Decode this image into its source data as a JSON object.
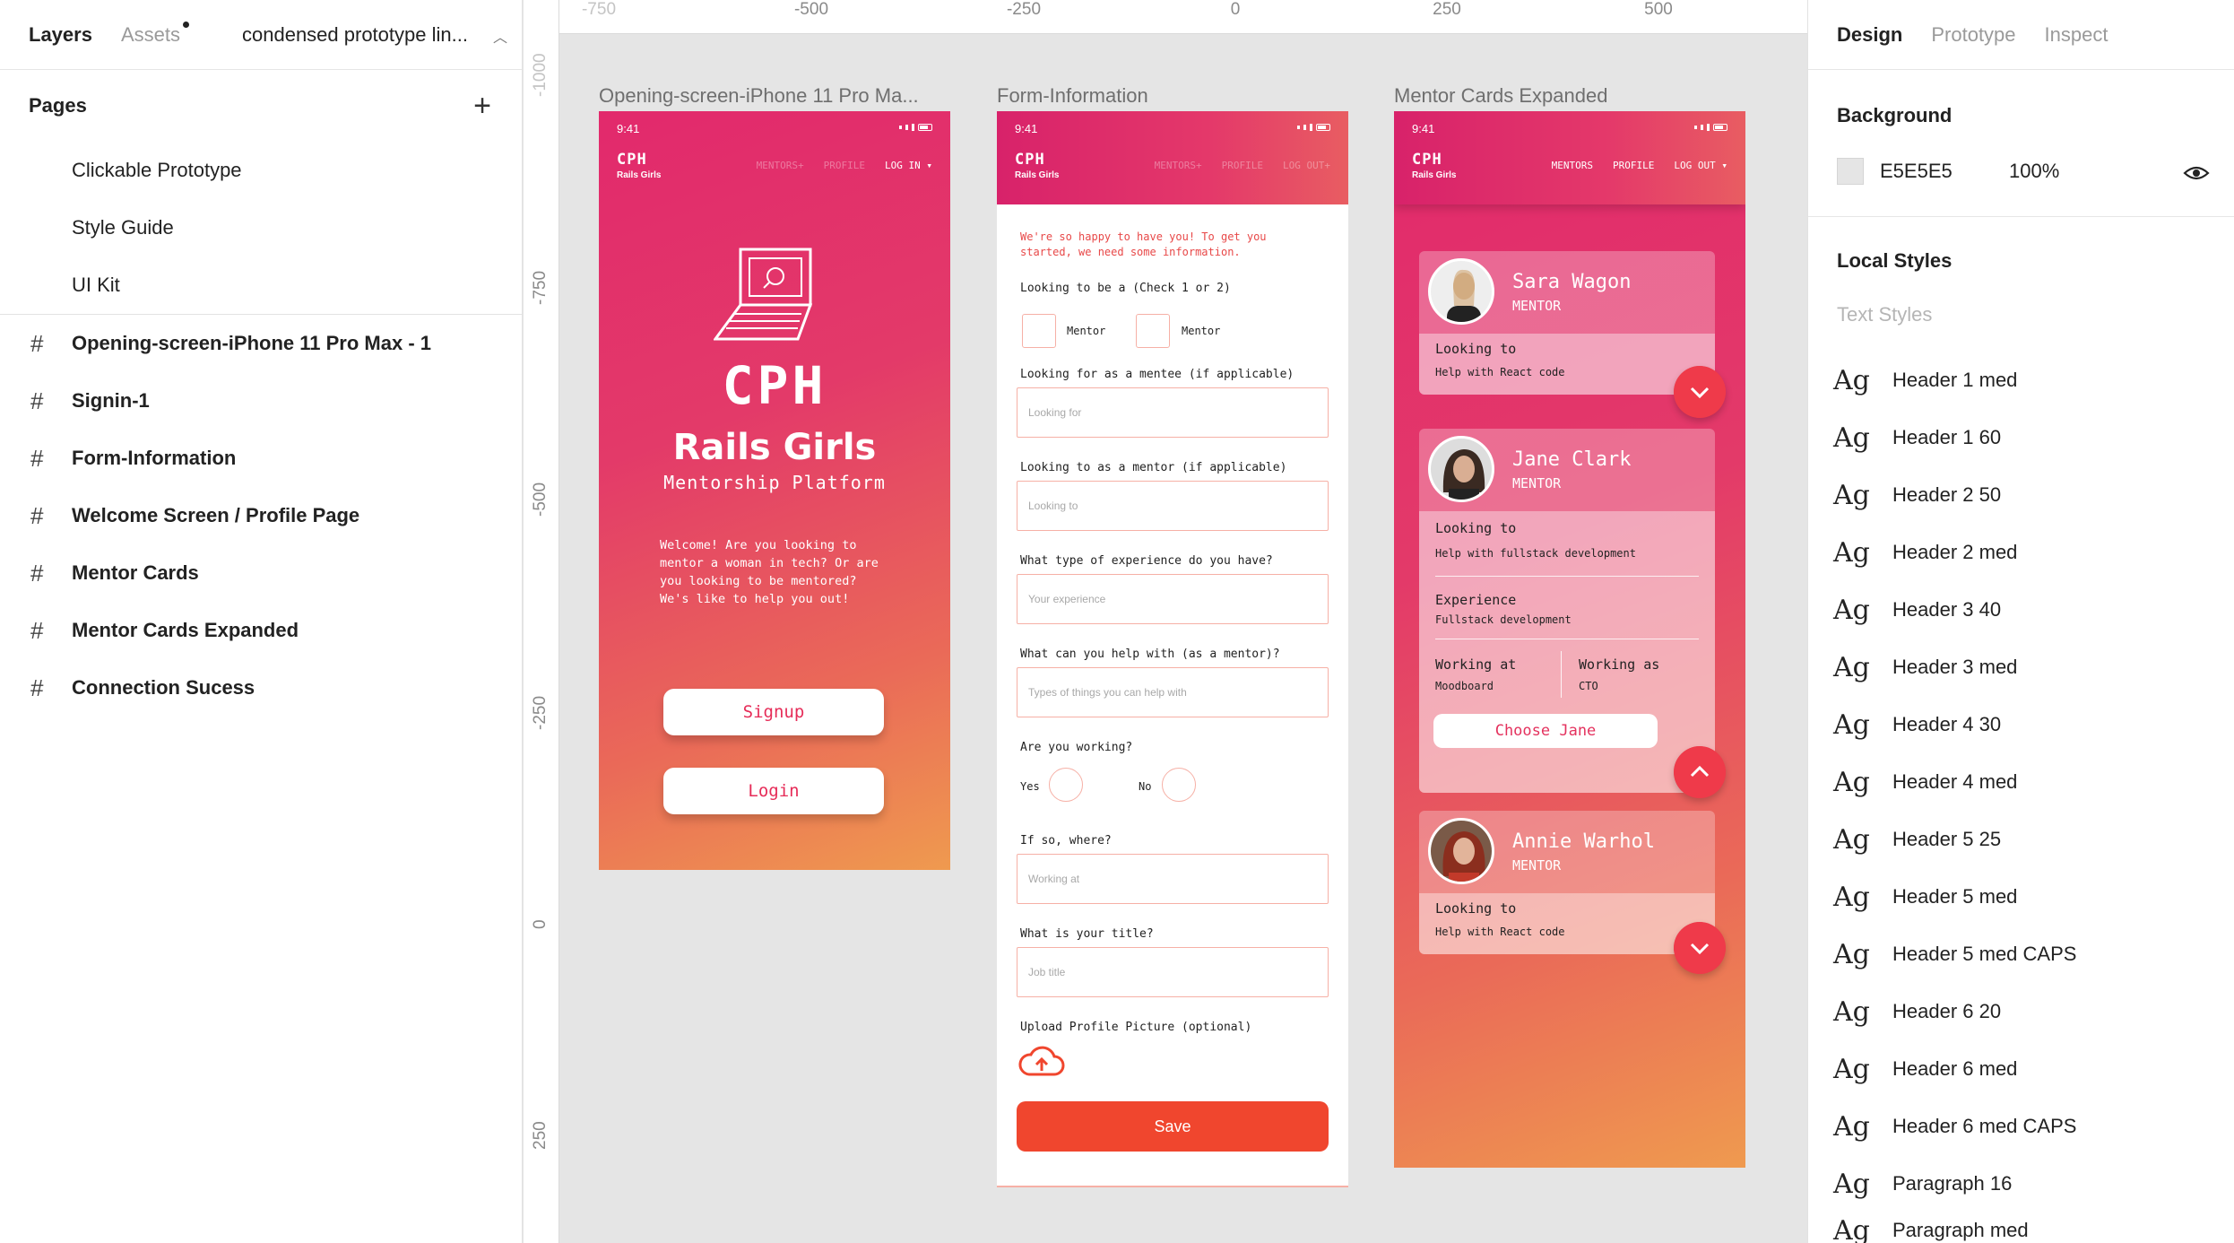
{
  "left_panel": {
    "tab_layers": "Layers",
    "tab_assets": "Assets",
    "project_name": "condensed prototype lin...",
    "pages_title": "Pages",
    "pages": [
      "Clickable Prototype",
      "Style Guide",
      "UI Kit"
    ],
    "frames": [
      "Opening-screen-iPhone 11 Pro Max - 1",
      "Signin-1",
      "Form-Information",
      "Welcome Screen / Profile Page",
      "Mentor Cards",
      "Mentor Cards Expanded",
      "Connection Sucess"
    ]
  },
  "ruler": {
    "top_labels": [
      "-750",
      "-500",
      "-250",
      "0",
      "250",
      "500"
    ],
    "left_labels": [
      "-1000",
      "-750",
      "-500",
      "-250",
      "0",
      "250"
    ]
  },
  "frame_titles": {
    "f1": "Opening-screen-iPhone 11 Pro Ma...",
    "f2": "Form-Information",
    "f3": "Mentor Cards Expanded"
  },
  "phone": {
    "time": "9:41",
    "logo": "CPH",
    "logo_sub": "Rails Girls",
    "nav_mentors": "MENTORS",
    "nav_mentors_plus": "MENTORS+",
    "nav_profile": "PROFILE",
    "nav_login": "LOG IN ▾",
    "nav_logout": "LOG OUT ▾",
    "nav_logout_plus": "LOG OUT+"
  },
  "opening": {
    "cph": "CPH",
    "title": "Rails Girls",
    "subtitle": "Mentorship Platform",
    "welcome": "Welcome! Are you looking to mentor a woman in tech? Or are you looking to be mentored? We's like to help you out!",
    "signup": "Signup",
    "login": "Login"
  },
  "form": {
    "intro": "We're so happy to have you! To get you started, we need some information.",
    "q_looking_to_be": "Looking to be a (Check 1 or 2)",
    "opt_mentor1": "Mentor",
    "opt_mentor2": "Mentor",
    "q_mentee": "Looking for as a mentee (if applicable)",
    "ph_mentee": "Looking for",
    "q_mentor": "Looking to as a mentor (if applicable)",
    "ph_mentor": "Looking to",
    "q_experience": "What type of experience do you have?",
    "ph_experience": "Your experience",
    "q_help": "What can you help with (as a mentor)?",
    "ph_help": "Types of things you can help with",
    "q_working": "Are you working?",
    "opt_yes": "Yes",
    "opt_no": "No",
    "q_where": "If so, where?",
    "ph_where": "Working at",
    "q_title": "What is your title?",
    "ph_title": "Job title",
    "q_upload": "Upload Profile Picture (optional)",
    "save": "Save"
  },
  "mentors": [
    {
      "name": "Sara Wagon",
      "role": "MENTOR",
      "looking_label": "Looking to",
      "looking": "Help with React code"
    },
    {
      "name": "Jane Clark",
      "role": "MENTOR",
      "looking_label": "Looking to",
      "looking": "Help with fullstack development",
      "exp_label": "Experience",
      "exp": "Fullstack development",
      "work_at_label": "Working at",
      "work_at": "Moodboard",
      "work_as_label": "Working as",
      "work_as": "CTO",
      "choose": "Choose Jane"
    },
    {
      "name": "Annie Warhol",
      "role": "MENTOR",
      "looking_label": "Looking to",
      "looking": "Help with React code"
    }
  ],
  "right_panel": {
    "tab_design": "Design",
    "tab_prototype": "Prototype",
    "tab_inspect": "Inspect",
    "background_title": "Background",
    "bg_hex": "E5E5E5",
    "bg_opacity": "100%",
    "local_styles": "Local Styles",
    "text_styles": "Text Styles",
    "ag": "Ag",
    "styles": [
      "Header 1 med",
      "Header 1 60",
      "Header 2 50",
      "Header 2 med",
      "Header 3 40",
      "Header 3 med",
      "Header 4 30",
      "Header 4 med",
      "Header 5 25",
      "Header 5 med",
      "Header 5 med CAPS",
      "Header 6 20",
      "Header 6 med",
      "Header 6 med CAPS",
      "Paragraph 16",
      "Paragraph med"
    ]
  },
  "colors": {
    "accent": "#e62c58",
    "save_button": "#f0462e",
    "canvas_bg": "#E5E5E5"
  }
}
